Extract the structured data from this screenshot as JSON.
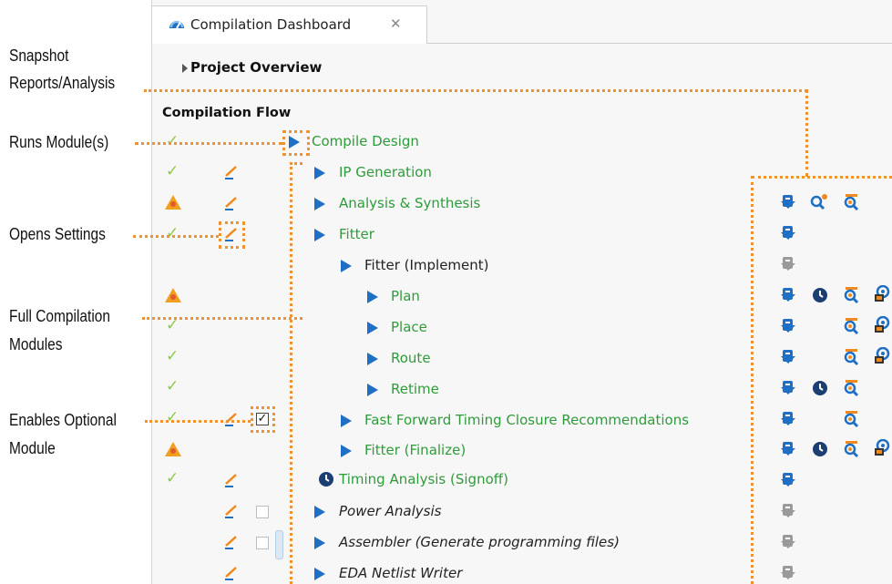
{
  "annotations": {
    "snapshot_1": "Snapshot",
    "snapshot_2": "Reports/Analysis",
    "runs": "Runs Module(s)",
    "opens": "Opens Settings",
    "full_1": "Full Compilation",
    "full_2": "Modules",
    "enables_1": "Enables Optional",
    "enables_2": "Module"
  },
  "tab": {
    "title": "Compilation Dashboard",
    "close": "✕",
    "icon": "dashboard-gauge-icon"
  },
  "project_overview": "Project Overview",
  "compilation_flow": "Compilation Flow",
  "colors": {
    "accent": "#1f6fc4",
    "task_done": "#2e9c3a",
    "callout": "#f0922e",
    "check": "#8ccc3c",
    "warning": "#f0a020"
  },
  "rows": [
    {
      "label": "Compile Design",
      "status": "check",
      "style": "green"
    },
    {
      "label": "IP Generation",
      "status": "check",
      "settings": true,
      "style": "green"
    },
    {
      "label": "Analysis & Synthesis",
      "status": "warning",
      "settings": true,
      "style": "green",
      "reports": [
        "report-icon",
        "search-new-icon",
        "search-report-icon"
      ]
    },
    {
      "label": "Fitter",
      "status": "check",
      "settings": true,
      "style": "green",
      "reports": [
        "report-icon"
      ]
    },
    {
      "label": "Fitter (Implement)",
      "style": "dark",
      "reports": [
        "report-disabled-icon"
      ]
    },
    {
      "label": "Plan",
      "status": "warning",
      "style": "green",
      "reports": [
        "report-icon",
        "clock-icon",
        "search-report-icon",
        "chip-planner-icon"
      ]
    },
    {
      "label": "Place",
      "status": "check",
      "style": "green",
      "reports": [
        "report-icon",
        "search-report-icon",
        "chip-planner-icon"
      ]
    },
    {
      "label": "Route",
      "status": "check",
      "style": "green",
      "reports": [
        "report-icon",
        "search-report-icon",
        "chip-planner-icon"
      ]
    },
    {
      "label": "Retime",
      "status": "check",
      "style": "green",
      "reports": [
        "report-icon",
        "clock-icon",
        "search-report-icon"
      ]
    },
    {
      "label": "Fast Forward Timing Closure Recommendations",
      "status": "check",
      "settings": true,
      "optional": "checked",
      "style": "green",
      "reports": [
        "report-icon",
        "search-report-icon"
      ]
    },
    {
      "label": "Fitter (Finalize)",
      "status": "warning",
      "style": "green",
      "reports": [
        "report-icon",
        "clock-icon",
        "search-report-icon",
        "chip-planner-icon"
      ]
    },
    {
      "label": "Timing Analysis (Signoff)",
      "status": "check",
      "settings": true,
      "style": "green",
      "reports": [
        "report-icon"
      ]
    },
    {
      "label": "Power Analysis",
      "settings": true,
      "optional": "unchecked",
      "style": "italic",
      "reports": [
        "report-disabled-icon"
      ]
    },
    {
      "label": "Assembler (Generate programming files)",
      "settings": true,
      "optional": "unchecked",
      "style": "italic",
      "reports": [
        "report-disabled-icon"
      ]
    },
    {
      "label": "EDA Netlist Writer",
      "settings": true,
      "style": "italic",
      "reports": [
        "report-disabled-icon"
      ]
    }
  ]
}
